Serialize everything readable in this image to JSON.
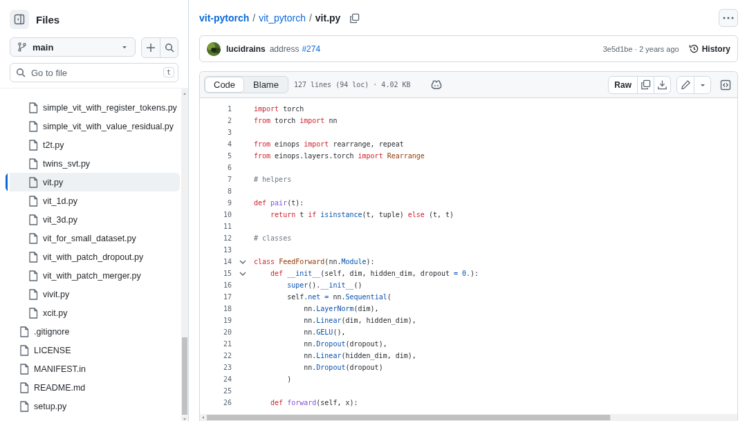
{
  "sidebar": {
    "title": "Files",
    "branch": "main",
    "search": {
      "placeholder": "Go to file",
      "shortcut": "t"
    },
    "items": [
      {
        "name": "simple_vit_with_register_tokens.py",
        "nested": true,
        "selected": false
      },
      {
        "name": "simple_vit_with_value_residual.py",
        "nested": true,
        "selected": false
      },
      {
        "name": "t2t.py",
        "nested": true,
        "selected": false
      },
      {
        "name": "twins_svt.py",
        "nested": true,
        "selected": false
      },
      {
        "name": "vit.py",
        "nested": true,
        "selected": true
      },
      {
        "name": "vit_1d.py",
        "nested": true,
        "selected": false
      },
      {
        "name": "vit_3d.py",
        "nested": true,
        "selected": false
      },
      {
        "name": "vit_for_small_dataset.py",
        "nested": true,
        "selected": false
      },
      {
        "name": "vit_with_patch_dropout.py",
        "nested": true,
        "selected": false
      },
      {
        "name": "vit_with_patch_merger.py",
        "nested": true,
        "selected": false
      },
      {
        "name": "vivit.py",
        "nested": true,
        "selected": false
      },
      {
        "name": "xcit.py",
        "nested": true,
        "selected": false
      },
      {
        "name": ".gitignore",
        "nested": false,
        "selected": false
      },
      {
        "name": "LICENSE",
        "nested": false,
        "selected": false
      },
      {
        "name": "MANIFEST.in",
        "nested": false,
        "selected": false
      },
      {
        "name": "README.md",
        "nested": false,
        "selected": false
      },
      {
        "name": "setup.py",
        "nested": false,
        "selected": false
      }
    ]
  },
  "breadcrumb": [
    {
      "text": "vit-pytorch",
      "kind": "repo"
    },
    {
      "text": "vit_pytorch",
      "kind": "folder"
    },
    {
      "text": "vit.py",
      "kind": "file"
    }
  ],
  "separator": "/",
  "commit": {
    "author": "lucidrains",
    "message": "address",
    "pr": "#274",
    "sha": "3e5d1be",
    "dot": "·",
    "time": "2 years ago",
    "history": "History"
  },
  "tabs": [
    {
      "label": "Code",
      "selected": true
    },
    {
      "label": "Blame",
      "selected": false
    }
  ],
  "file_info": "127 lines (94 loc) · 4.02 KB",
  "raw": "Raw",
  "lines": [
    {
      "number": "1",
      "foldable": false,
      "tokens": [
        {
          "kind": "kw",
          "text": "import"
        },
        {
          "kind": "pl",
          "text": " torch"
        }
      ]
    },
    {
      "number": "2",
      "foldable": false,
      "tokens": [
        {
          "kind": "kw",
          "text": "from"
        },
        {
          "kind": "pl",
          "text": " torch "
        },
        {
          "kind": "kw",
          "text": "import"
        },
        {
          "kind": "pl",
          "text": " nn"
        }
      ]
    },
    {
      "number": "3",
      "foldable": false
    },
    {
      "number": "4",
      "foldable": false,
      "tokens": [
        {
          "kind": "kw",
          "text": "from"
        },
        {
          "kind": "pl",
          "text": " einops "
        },
        {
          "kind": "kw",
          "text": "import"
        },
        {
          "kind": "pl",
          "text": " rearrange, repeat"
        }
      ]
    },
    {
      "number": "5",
      "foldable": false,
      "tokens": [
        {
          "kind": "kw",
          "text": "from"
        },
        {
          "kind": "pl",
          "text": " einops.layers.torch "
        },
        {
          "kind": "kw",
          "text": "import"
        },
        {
          "kind": "cls",
          "text": " Rearrange"
        }
      ]
    },
    {
      "number": "6",
      "foldable": false
    },
    {
      "number": "7",
      "foldable": false,
      "tokens": [
        {
          "kind": "cm",
          "text": "# helpers"
        }
      ]
    },
    {
      "number": "8",
      "foldable": false
    },
    {
      "number": "9",
      "foldable": false,
      "tokens": [
        {
          "kind": "kw",
          "text": "def"
        },
        {
          "kind": "fn",
          "text": " pair"
        },
        {
          "kind": "pl",
          "text": "(t):"
        }
      ]
    },
    {
      "number": "10",
      "foldable": false,
      "tokens": [
        {
          "kind": "kw",
          "text": "    return"
        },
        {
          "kind": "pl",
          "text": " t "
        },
        {
          "kind": "kw",
          "text": "if"
        },
        {
          "kind": "bi",
          "text": " isinstance"
        },
        {
          "kind": "pl",
          "text": "(t, tuple) "
        },
        {
          "kind": "kw",
          "text": "else"
        },
        {
          "kind": "pl",
          "text": " (t, t)"
        }
      ]
    },
    {
      "number": "11",
      "foldable": false
    },
    {
      "number": "12",
      "foldable": false,
      "tokens": [
        {
          "kind": "cm",
          "text": "# classes"
        }
      ]
    },
    {
      "number": "13",
      "foldable": false
    },
    {
      "number": "14",
      "foldable": true,
      "tokens": [
        {
          "kind": "kw",
          "text": "class"
        },
        {
          "kind": "cls",
          "text": " FeedForward"
        },
        {
          "kind": "pl",
          "text": "(nn."
        },
        {
          "kind": "bi",
          "text": "Module"
        },
        {
          "kind": "pl",
          "text": "):"
        }
      ]
    },
    {
      "number": "15",
      "foldable": true,
      "tokens": [
        {
          "kind": "kw",
          "text": "    def"
        },
        {
          "kind": "bi",
          "text": " __init__"
        },
        {
          "kind": "pl",
          "text": "(self, dim, hidden_dim, dropout "
        },
        {
          "kind": "bi",
          "text": "= 0."
        },
        {
          "kind": "pl",
          "text": "):"
        }
      ]
    },
    {
      "number": "16",
      "foldable": false,
      "tokens": [
        {
          "kind": "bi",
          "text": "        super"
        },
        {
          "kind": "pl",
          "text": "()."
        },
        {
          "kind": "bi",
          "text": "__init__"
        },
        {
          "kind": "pl",
          "text": "()"
        }
      ]
    },
    {
      "number": "17",
      "foldable": false,
      "tokens": [
        {
          "kind": "pl",
          "text": "        self."
        },
        {
          "kind": "bi",
          "text": "net ="
        },
        {
          "kind": "pl",
          "text": " nn."
        },
        {
          "kind": "bi",
          "text": "Sequential"
        },
        {
          "kind": "pl",
          "text": "("
        }
      ]
    },
    {
      "number": "18",
      "foldable": false,
      "tokens": [
        {
          "kind": "pl",
          "text": "            nn."
        },
        {
          "kind": "bi",
          "text": "LayerNorm"
        },
        {
          "kind": "pl",
          "text": "(dim),"
        }
      ]
    },
    {
      "number": "19",
      "foldable": false,
      "tokens": [
        {
          "kind": "pl",
          "text": "            nn."
        },
        {
          "kind": "bi",
          "text": "Linear"
        },
        {
          "kind": "pl",
          "text": "(dim, hidden_dim),"
        }
      ]
    },
    {
      "number": "20",
      "foldable": false,
      "tokens": [
        {
          "kind": "pl",
          "text": "            nn."
        },
        {
          "kind": "bi",
          "text": "GELU"
        },
        {
          "kind": "pl",
          "text": "(),"
        }
      ]
    },
    {
      "number": "21",
      "foldable": false,
      "tokens": [
        {
          "kind": "pl",
          "text": "            nn."
        },
        {
          "kind": "bi",
          "text": "Dropout"
        },
        {
          "kind": "pl",
          "text": "(dropout),"
        }
      ]
    },
    {
      "number": "22",
      "foldable": false,
      "tokens": [
        {
          "kind": "pl",
          "text": "            nn."
        },
        {
          "kind": "bi",
          "text": "Linear"
        },
        {
          "kind": "pl",
          "text": "(hidden_dim, dim),"
        }
      ]
    },
    {
      "number": "23",
      "foldable": false,
      "tokens": [
        {
          "kind": "pl",
          "text": "            nn."
        },
        {
          "kind": "bi",
          "text": "Dropout"
        },
        {
          "kind": "pl",
          "text": "(dropout)"
        }
      ]
    },
    {
      "number": "24",
      "foldable": false,
      "tokens": [
        {
          "kind": "pl",
          "text": "        )"
        }
      ]
    },
    {
      "number": "25",
      "foldable": false
    },
    {
      "number": "26",
      "foldable": false,
      "tokens": [
        {
          "kind": "kw",
          "text": "    def"
        },
        {
          "kind": "fn",
          "text": " forward"
        },
        {
          "kind": "pl",
          "text": "(self, x):"
        }
      ]
    }
  ]
}
